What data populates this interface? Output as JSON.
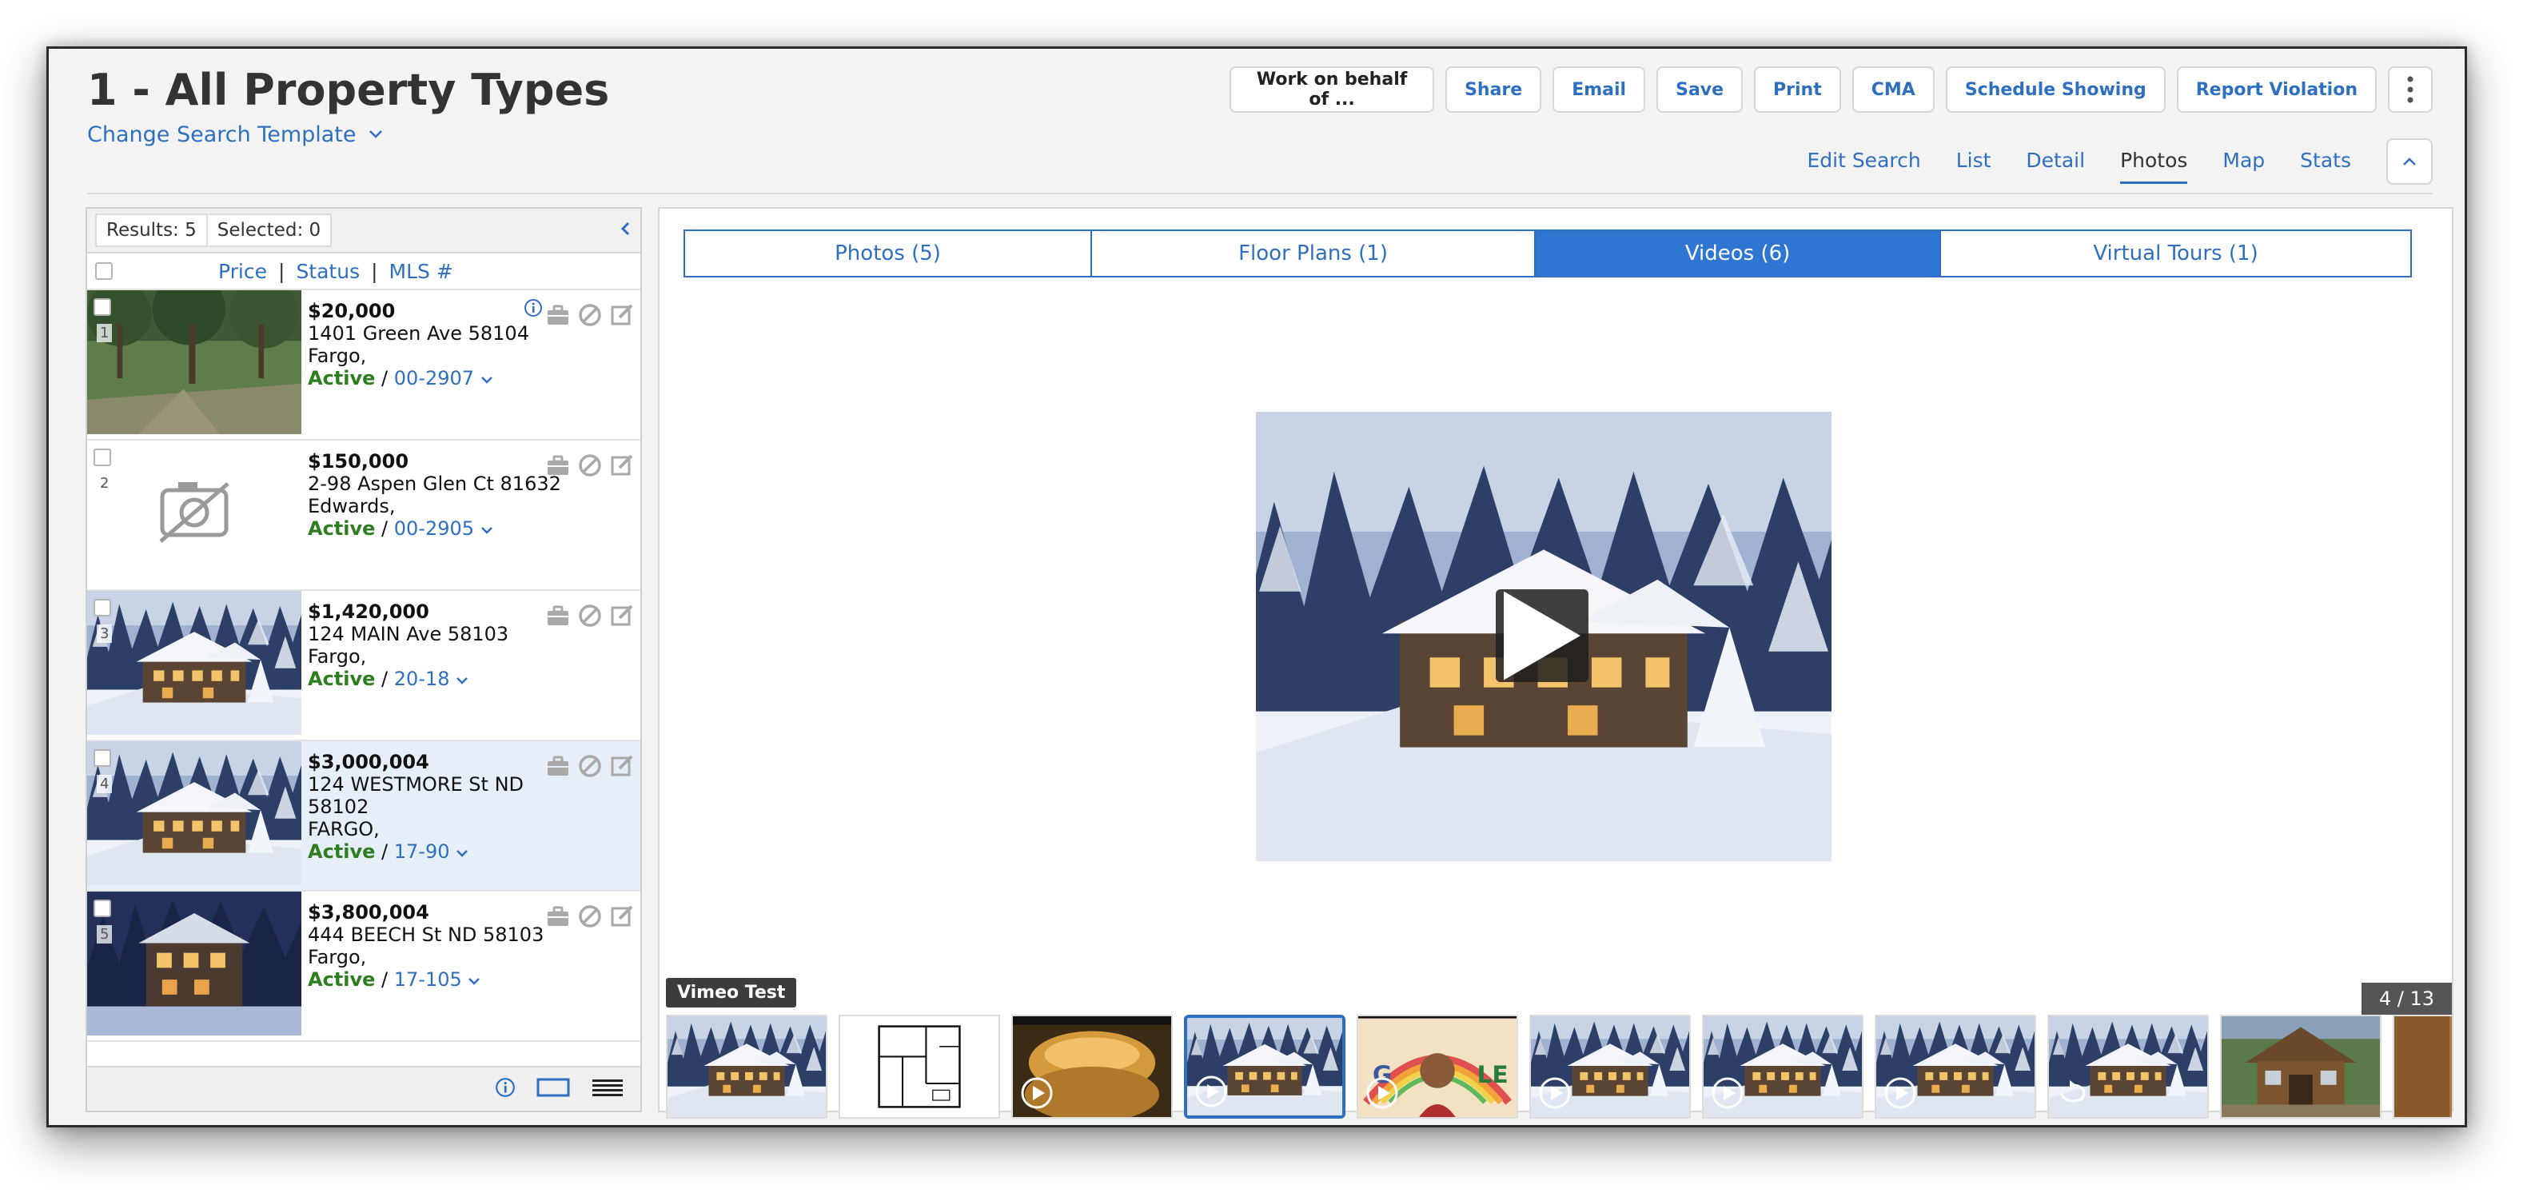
{
  "header": {
    "title": "1 - All Property Types",
    "template_link": "Change Search Template",
    "actions": {
      "behalf": "Work on behalf of ...",
      "share": "Share",
      "email": "Email",
      "save": "Save",
      "print": "Print",
      "cma": "CMA",
      "schedule": "Schedule Showing",
      "report": "Report Violation"
    },
    "views": [
      "Edit Search",
      "List",
      "Detail",
      "Photos",
      "Map",
      "Stats"
    ],
    "active_view": "Photos"
  },
  "list_panel": {
    "results": "Results: 5",
    "selected": "Selected: 0",
    "sort": {
      "price": "Price",
      "status": "Status",
      "mls": "MLS #",
      "sep": "|"
    },
    "listings": [
      {
        "num": "1",
        "price": "$20,000",
        "address": [
          "1401 Green Ave 58104",
          "Fargo,"
        ],
        "status": "Active",
        "mls": "00-2907"
      },
      {
        "num": "2",
        "price": "$150,000",
        "address": [
          "2-98 Aspen Glen Ct 81632",
          "Edwards,"
        ],
        "status": "Active",
        "mls": "00-2905"
      },
      {
        "num": "3",
        "price": "$1,420,000",
        "address": [
          "124 MAIN Ave 58103",
          "Fargo,"
        ],
        "status": "Active",
        "mls": "20-18"
      },
      {
        "num": "4",
        "price": "$3,000,004",
        "address": [
          "124 WESTMORE St ND",
          "58102",
          "FARGO,"
        ],
        "status": "Active",
        "mls": "17-90"
      },
      {
        "num": "5",
        "price": "$3,800,004",
        "address": [
          "444 BEECH St ND 58103",
          "Fargo,"
        ],
        "status": "Active",
        "mls": "17-105"
      }
    ],
    "status_sep": " / "
  },
  "media": {
    "tabs": [
      "Photos (5)",
      "Floor Plans (1)",
      "Videos (6)",
      "Virtual Tours (1)"
    ],
    "active_tab": "Videos (6)",
    "caption": "Vimeo Test",
    "counter": "4 / 13"
  },
  "colors": {
    "link": "#2f6fbf",
    "active_tab": "#2f76d2",
    "status_active": "#2e7d1f",
    "selected_row": "#e6eef8"
  }
}
